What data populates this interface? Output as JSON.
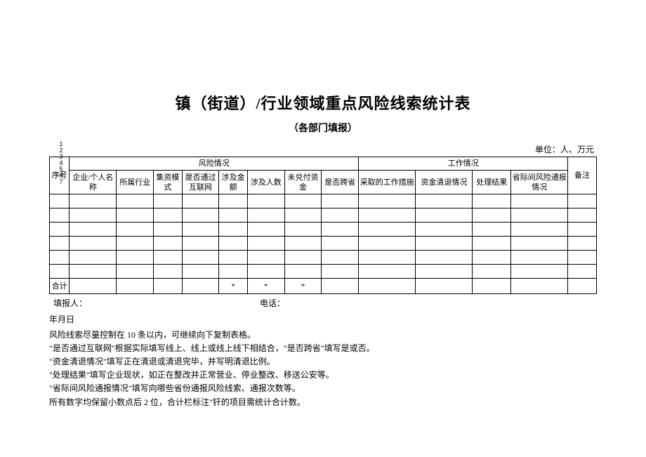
{
  "title": "镇（街道）/行业领域重点风险线索统计表",
  "subtitle": "（各部门填报）",
  "unit_label": "单位：人、万元",
  "vertical_code": "1234567",
  "headers": {
    "seq": "序号",
    "risk_group": "风险情况",
    "work_group": "工作情况",
    "remark": "备注",
    "name": "企业/个人名称",
    "industry": "所属行业",
    "mode": "集资模式",
    "internet": "是否通过互联网",
    "amount": "涉及金额",
    "people": "涉及人数",
    "unpaid": "未兑付资金",
    "cross": "是否跨省",
    "measures": "采取的工作措施",
    "fund_clear": "资金清退情况",
    "result": "处理结果",
    "inter_prov": "省际间风险通报情况"
  },
  "total_row": {
    "label": "合计",
    "star": "*"
  },
  "footer": {
    "reporter_label": "填报人：",
    "phone_label": "电话：",
    "date_label": "年月日"
  },
  "notes": [
    "风险线索尽量控制在 10 条以内，可继续向下复制表格。",
    "\"是否通过互联网\"根据实际填写线上、线上或线上线下相结合，\"是否跨省\"填写是或否。",
    "\"资金清退情况\"填写正在清退或清退完毕，并写明清退比例。",
    "\"处理结果\"填写企业现状，如正在整改并正常营业、停业整改、移送公安等。",
    "\"省际间风险通报情况\"填写向哪些省份通报风险线索、通报次数等。",
    "所有数字均保留小数点后 2 位，合计栏标注\"钎的项目需统计合计数。"
  ]
}
